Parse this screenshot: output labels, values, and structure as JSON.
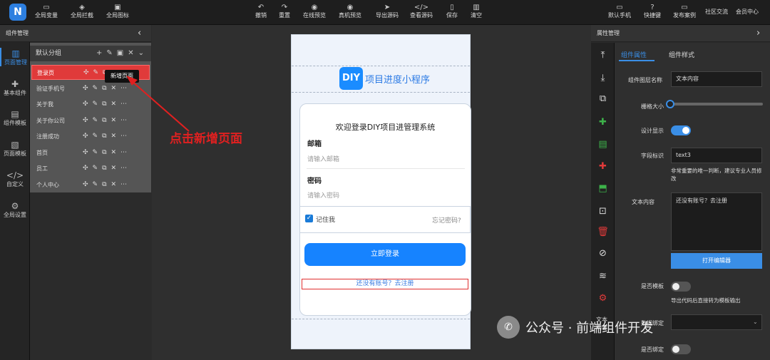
{
  "topbar": {
    "left": [
      {
        "icon": "▭",
        "label": "全局变量"
      },
      {
        "icon": "◈",
        "label": "全局拦截"
      },
      {
        "icon": "▣",
        "label": "全局图标"
      }
    ],
    "center": [
      {
        "icon": "↶",
        "label": "撤销"
      },
      {
        "icon": "↷",
        "label": "重置"
      },
      {
        "icon": "◉",
        "label": "在线预览"
      },
      {
        "icon": "◉",
        "label": "真机预览"
      },
      {
        "icon": "➤",
        "label": "导出源码"
      },
      {
        "icon": "</>",
        "label": "查看源码"
      },
      {
        "icon": "▯",
        "label": "保存"
      },
      {
        "icon": "▥",
        "label": "清空"
      }
    ],
    "right": [
      {
        "icon": "▭",
        "label": "默认手机"
      },
      {
        "icon": "?",
        "label": "快捷键"
      },
      {
        "icon": "▭",
        "label": "发布案例"
      },
      {
        "icon": "",
        "label": "社区交流"
      },
      {
        "icon": "",
        "label": "会员中心"
      }
    ]
  },
  "left_panel": {
    "title": "组件管理",
    "collapse": "‹"
  },
  "icon_rail": [
    {
      "icon": "▥",
      "label": "页面管理"
    },
    {
      "icon": "✚",
      "label": "基本组件"
    },
    {
      "icon": "▤",
      "label": "组件模板"
    },
    {
      "icon": "▧",
      "label": "页面模板"
    },
    {
      "icon": "</>",
      "label": "自定义"
    },
    {
      "icon": "⚙",
      "label": "全局设置"
    }
  ],
  "page_group": {
    "name": "默认分组",
    "icons": "+✎▣✕⌄"
  },
  "pages": [
    "登录页",
    "验证手机号",
    "关于我",
    "关于你公司",
    "注册成功",
    "首页",
    "员工",
    "个人中心"
  ],
  "row_actions": "✣✎⧉✕⋯",
  "tooltip": "新增页面",
  "annotation": "点击新增页面",
  "phone": {
    "logo": "DIY",
    "app_title": "项目进度小程序",
    "welcome": "欢迎登录DIY项目进管理系统",
    "email_label": "邮箱",
    "email_placeholder": "请输入邮箱",
    "password_label": "密码",
    "password_placeholder": "请输入密码",
    "remember": "记住我",
    "forgot": "忘记密码?",
    "login_button": "立即登录",
    "register_link": "还没有账号？去注册"
  },
  "tool_rail": [
    "⤒",
    "⤓",
    "⧉",
    "✚",
    "▤",
    "✚",
    "⬒",
    "⊡",
    "🗑",
    "⊘",
    "≋",
    "⚙"
  ],
  "tool_rail_text": "文本\n内容",
  "right_panel": {
    "title": "属性管理",
    "collapse": "›",
    "tabs": [
      "组件属性",
      "组件样式"
    ],
    "layer_name_label": "组件图层名称",
    "layer_name_value": "文本内容",
    "grid_label": "栅格大小",
    "design_show_label": "设计显示",
    "field_id_label": "字段标识",
    "field_id_value": "text3",
    "field_hint": "非常重要的唯一判断，建议专业人员修改",
    "text_content_label": "文本内容",
    "text_content_value": "还没有账号？去注册",
    "open_editor": "打开编辑器",
    "is_template_label": "是否模板",
    "template_hint": "导出代码后直接转为模板输出",
    "data_binding_label": "数据绑定",
    "more_label": "是否绑定"
  },
  "watermark": {
    "icon": "✆",
    "text": "公众号 · 前端组件开发"
  }
}
